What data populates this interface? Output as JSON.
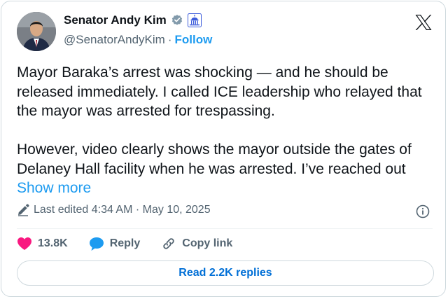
{
  "author": {
    "name": "Senator Andy Kim",
    "handle": "@SenatorAndyKim",
    "separator": "·",
    "follow_label": "Follow",
    "verified_icon": "verified-badge-icon",
    "affiliation_icon": "government-capitol-icon",
    "avatar": "profile-photo"
  },
  "post": {
    "paragraph1": "Mayor Baraka’s arrest was shocking — and he should be released immediately. I called ICE leadership who relayed that the mayor was arrested for trespassing.",
    "paragraph2": "However, video clearly shows the mayor outside the gates of Delaney Hall facility when he was arrested. I’ve reached out",
    "show_more": "Show more",
    "edited_text": "Last edited 4:34 AM · May 10, 2025"
  },
  "actions": {
    "likes": "13.8K",
    "reply_label": "Reply",
    "copy_link_label": "Copy link"
  },
  "footer": {
    "read_replies_label": "Read 2.2K replies"
  },
  "colors": {
    "accent": "#1d9bf0",
    "like": "#f91880",
    "text": "#0f1419",
    "muted": "#536471",
    "border": "#cfd9de"
  },
  "icons": [
    "verified-badge-icon",
    "government-capitol-icon",
    "x-logo-icon",
    "pencil-icon",
    "info-icon",
    "heart-icon",
    "speech-bubble-icon",
    "link-icon"
  ]
}
